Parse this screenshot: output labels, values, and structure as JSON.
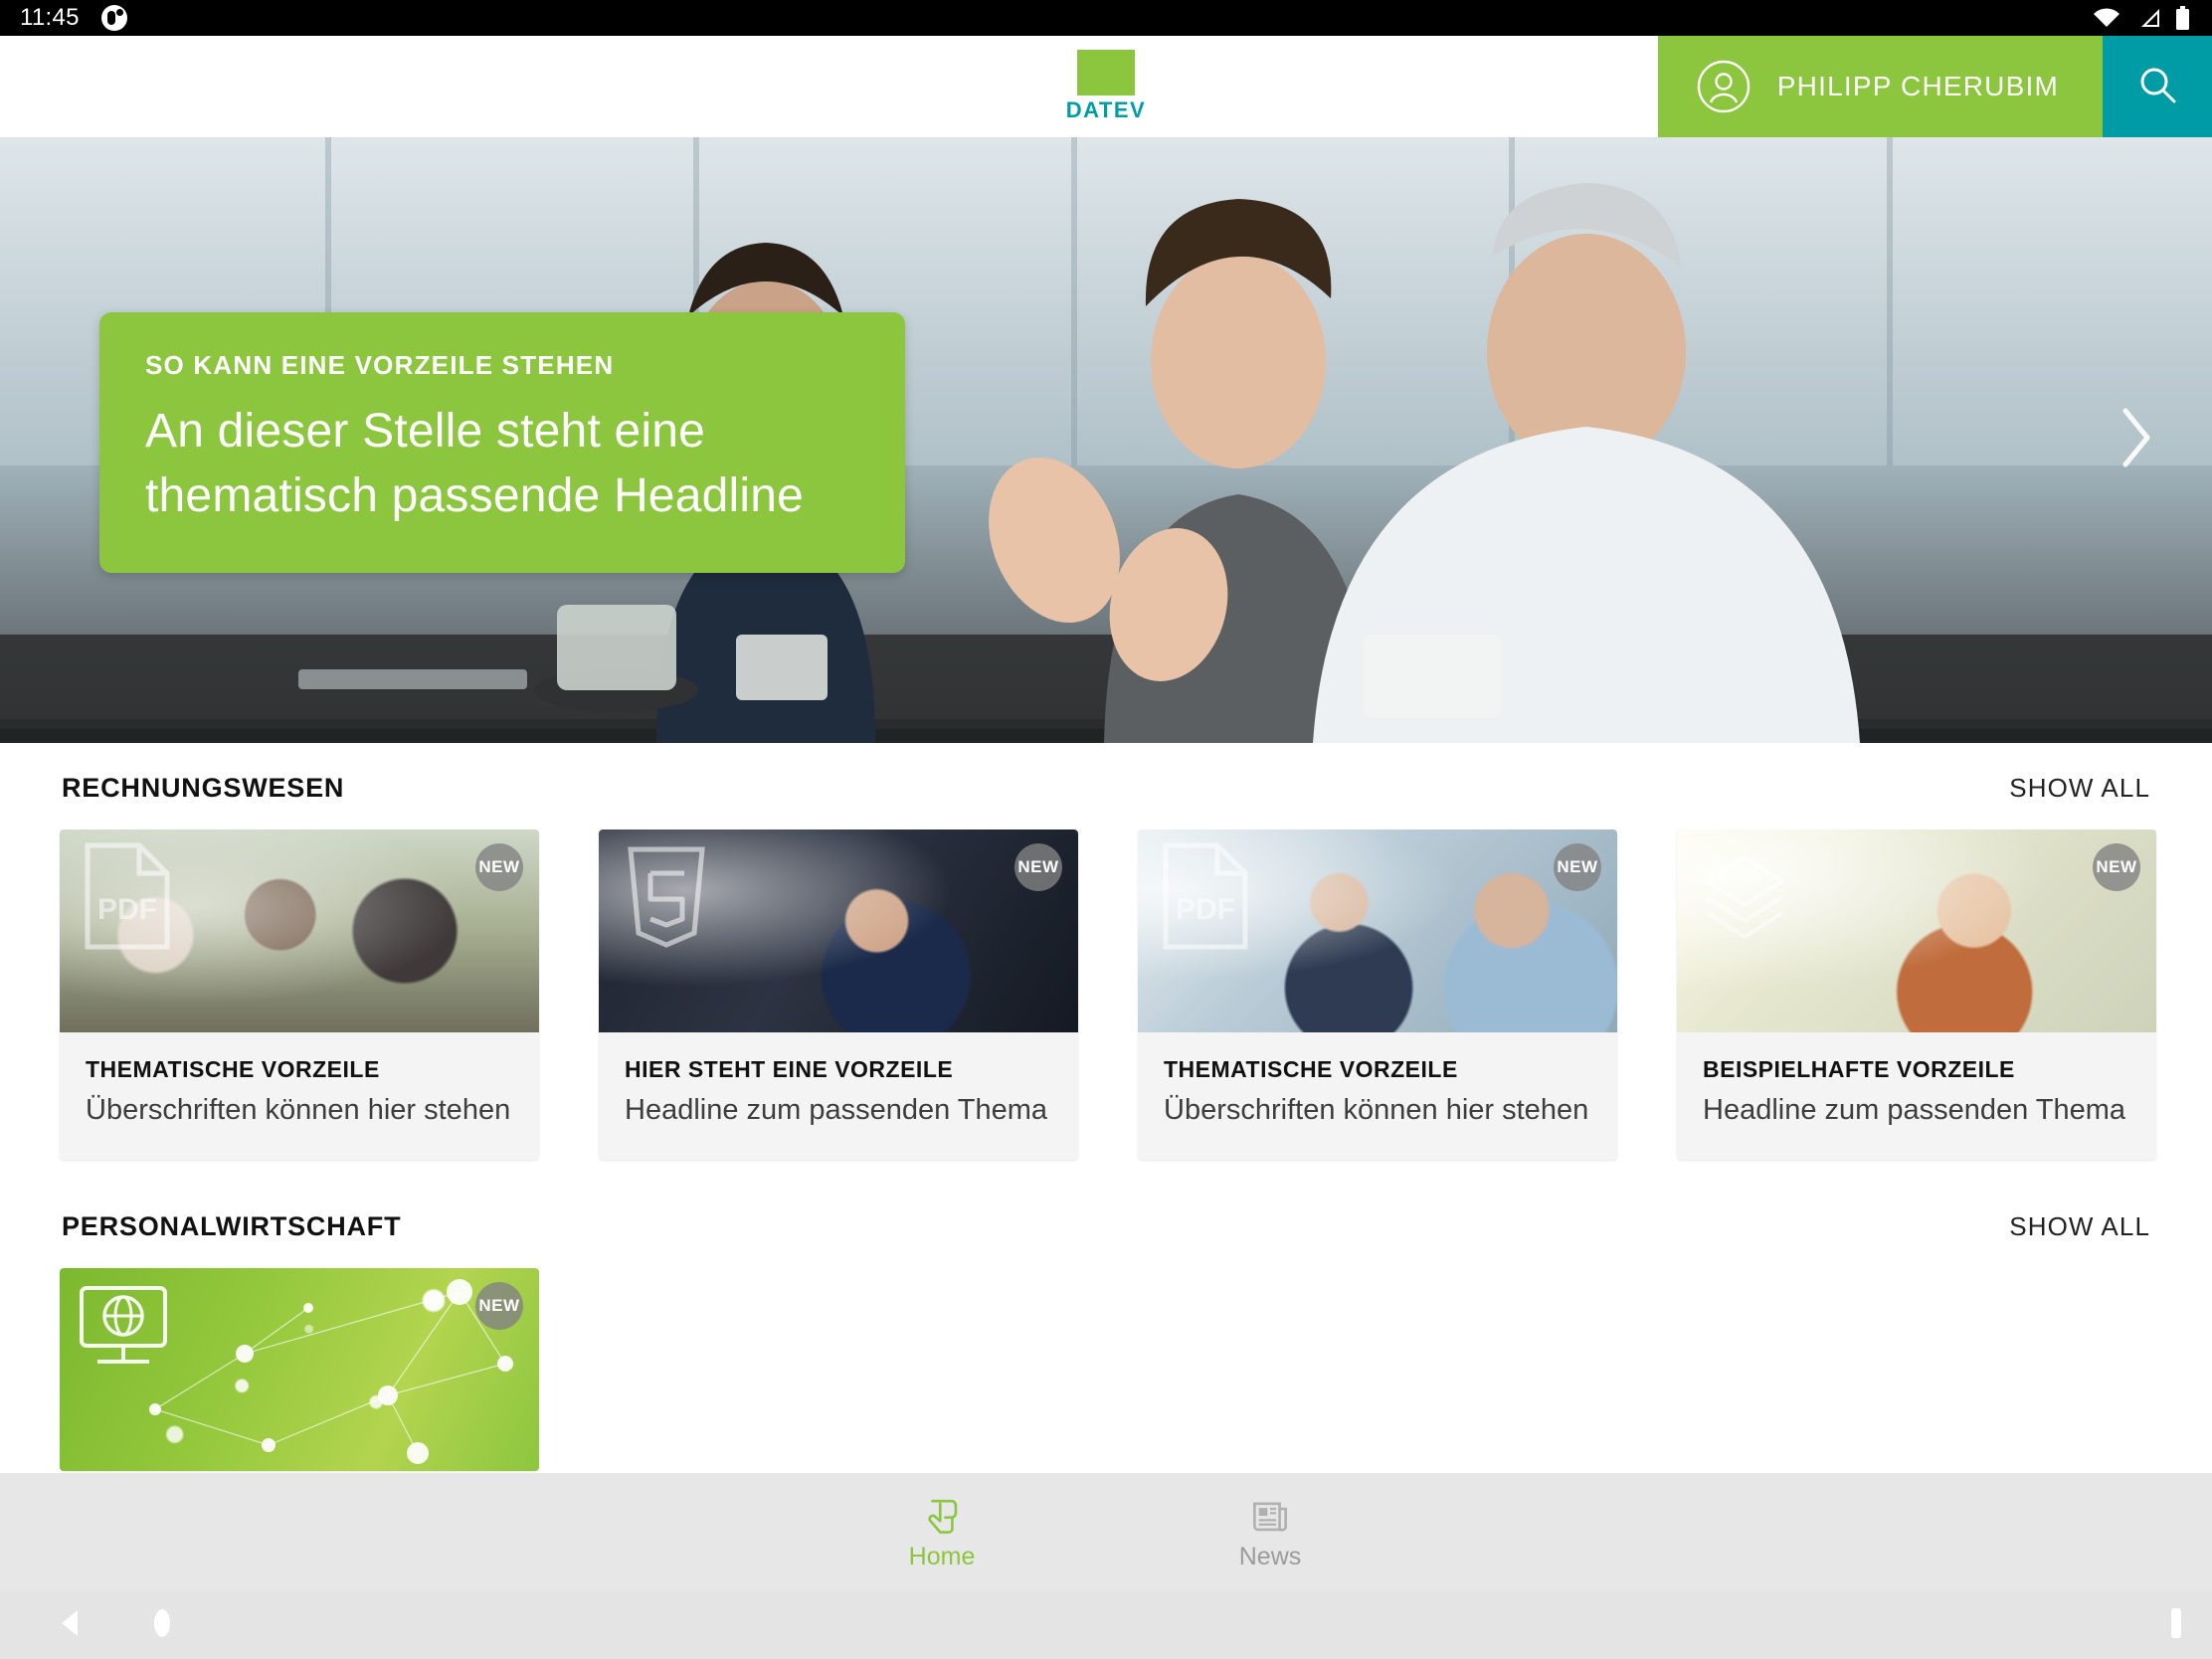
{
  "status_bar": {
    "time": "11:45",
    "app_icon": "app-badge-icon",
    "icons": [
      "wifi-icon",
      "cellular-signal-icon",
      "battery-icon"
    ]
  },
  "header": {
    "logo": {
      "brand": "DATEV",
      "square_color": "#8CC63F",
      "text_color": "#009CA6"
    },
    "user": {
      "name": "PHILIPP CHERUBIM",
      "avatar_icon": "user-avatar-icon",
      "background": "#8CC63F"
    },
    "search": {
      "icon": "search-icon",
      "background": "#009CA6"
    }
  },
  "hero": {
    "kicker": "SO KANN EINE VORZEILE STEHEN",
    "headline": "An dieser Stelle steht eine thematisch passende Headline",
    "overlay_color": "#8CC63F",
    "next_icon": "chevron-right-icon"
  },
  "sections": [
    {
      "title": "RECHNUNGSWESEN",
      "show_all": "SHOW ALL",
      "cards": [
        {
          "kicker": "THEMATISCHE VORZEILE",
          "title": "Überschriften können hier stehen",
          "badge": "NEW",
          "doc_icon": "pdf-document-icon",
          "photo": "ph1"
        },
        {
          "kicker": "HIER STEHT EINE VORZEILE",
          "title": "Headline zum passenden Thema",
          "badge": "NEW",
          "doc_icon": "html5-shield-icon",
          "photo": "ph2"
        },
        {
          "kicker": "THEMATISCHE VORZEILE",
          "title": "Überschriften können hier stehen",
          "badge": "NEW",
          "doc_icon": "pdf-document-icon",
          "photo": "ph3"
        },
        {
          "kicker": "BEISPIELHAFTE VORZEILE",
          "title": "Headline zum passenden Thema",
          "badge": "NEW",
          "doc_icon": "stacked-layers-icon",
          "photo": "ph4"
        }
      ]
    },
    {
      "title": "PERSONALWIRTSCHAFT",
      "show_all": "SHOW ALL",
      "cards": [
        {
          "kicker": "",
          "title": "",
          "badge": "NEW",
          "doc_icon": "monitor-globe-icon",
          "photo": "ph5"
        }
      ]
    }
  ],
  "tab_bar": {
    "background": "#E7E7E7",
    "active_color": "#8CC63F",
    "inactive_color": "#9B9B9B",
    "tabs": [
      {
        "label": "Home",
        "icon": "touch-hand-icon",
        "active": true
      },
      {
        "label": "News",
        "icon": "newspaper-icon",
        "active": false
      }
    ]
  },
  "nav_bar": {
    "back_icon": "triangle-back-icon",
    "home_icon": "circle-home-icon",
    "recents_icon": "recents-bar-icon"
  }
}
